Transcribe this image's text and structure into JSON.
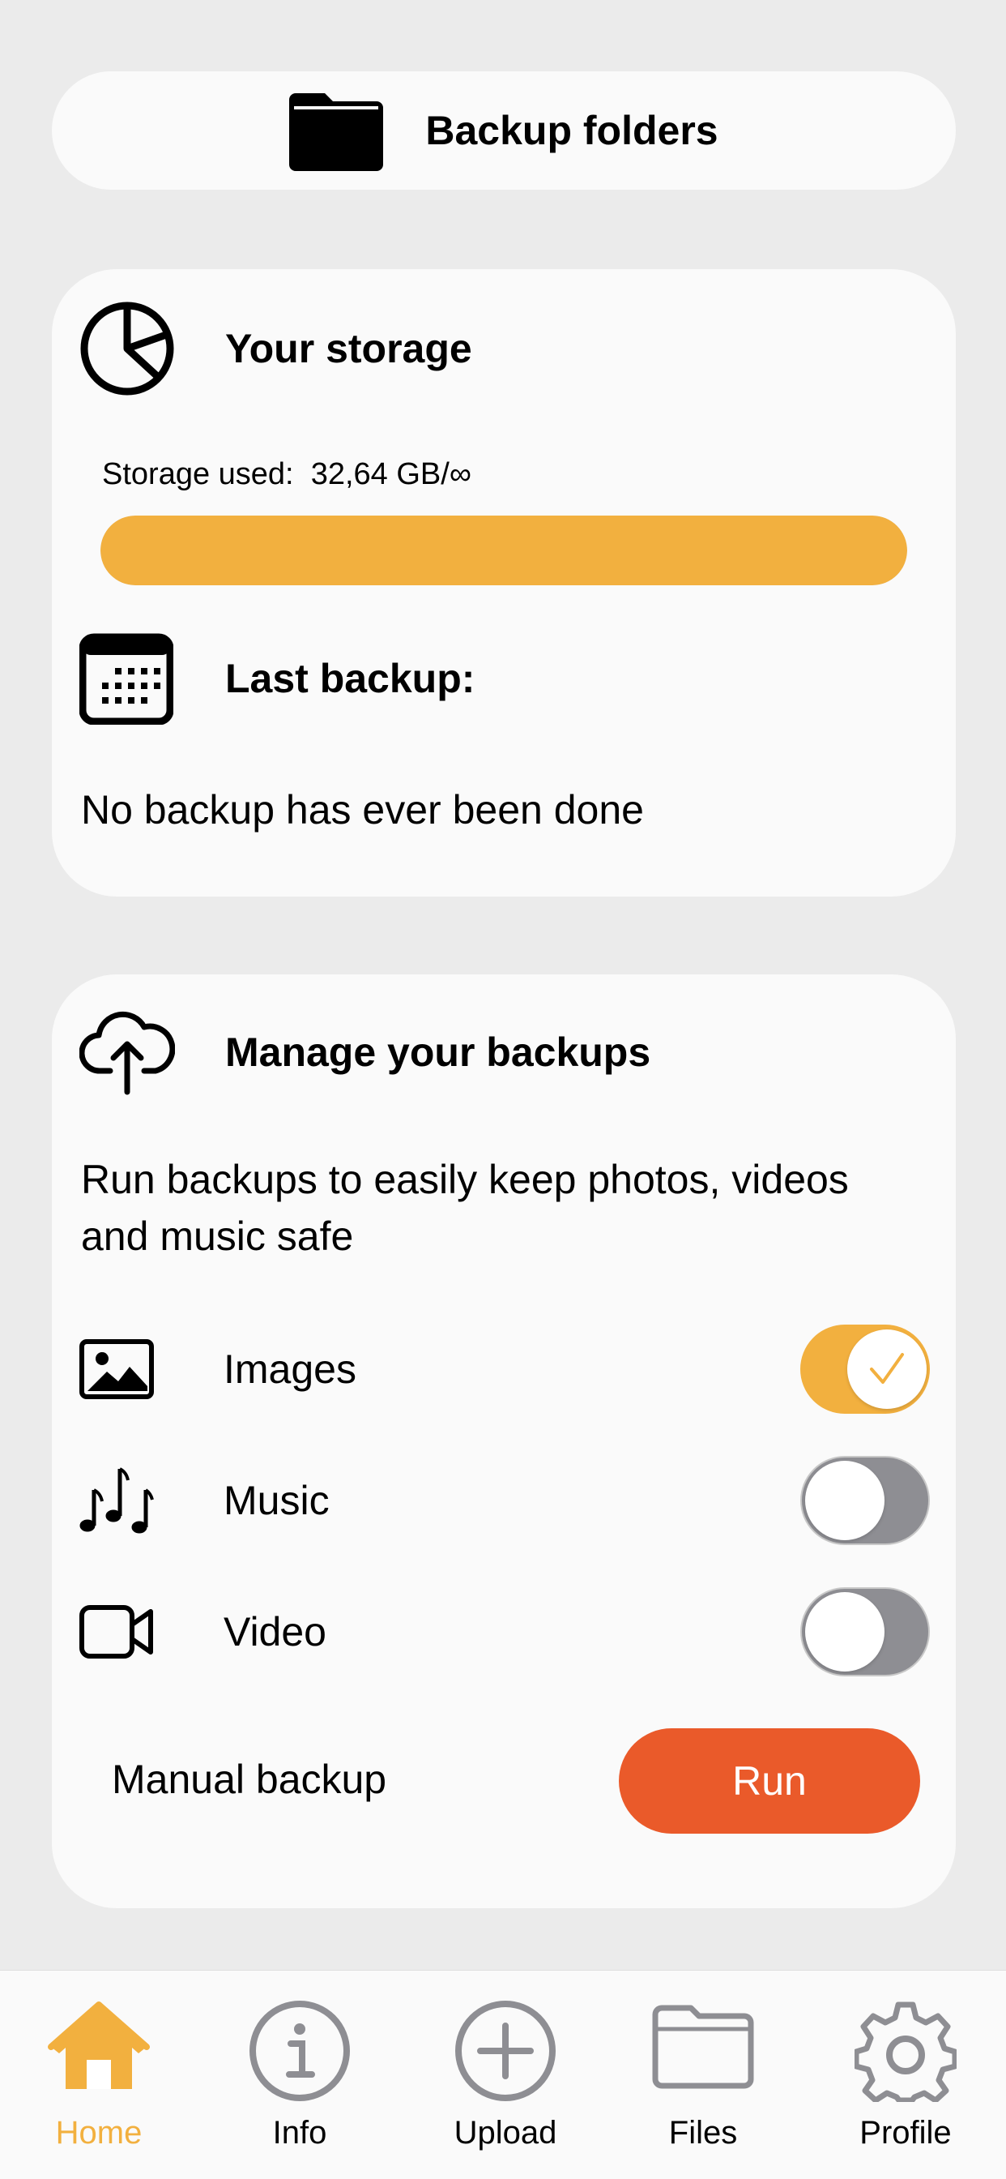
{
  "colors": {
    "accent": "#f2b03f",
    "run_button": "#ea5a2a",
    "background": "#ebebeb",
    "card": "#fafafa",
    "inactive_icon": "#8e8e93"
  },
  "backup_folders": {
    "label": "Backup folders",
    "icon": "folder-icon"
  },
  "storage": {
    "title": "Your storage",
    "icon": "pie-chart-icon",
    "used_label": "Storage used:  32,64 GB/∞",
    "progress_percent": 100
  },
  "last_backup": {
    "title": "Last backup:",
    "icon": "calendar-icon",
    "status": "No backup has ever been done"
  },
  "manage": {
    "title": "Manage your backups",
    "icon": "cloud-upload-icon",
    "description": "Run backups to easily keep photos, videos and music safe",
    "toggles": [
      {
        "label": "Images",
        "icon": "image-icon",
        "on": true
      },
      {
        "label": "Music",
        "icon": "music-notes-icon",
        "on": false
      },
      {
        "label": "Video",
        "icon": "video-camera-icon",
        "on": false
      }
    ],
    "manual_label": "Manual backup",
    "run_label": "Run"
  },
  "tabbar": {
    "active": "Home",
    "tabs": [
      {
        "label": "Home",
        "icon": "home-icon"
      },
      {
        "label": "Info",
        "icon": "info-icon"
      },
      {
        "label": "Upload",
        "icon": "plus-circle-icon"
      },
      {
        "label": "Files",
        "icon": "folder-outline-icon"
      },
      {
        "label": "Profile",
        "icon": "gear-icon"
      }
    ]
  }
}
